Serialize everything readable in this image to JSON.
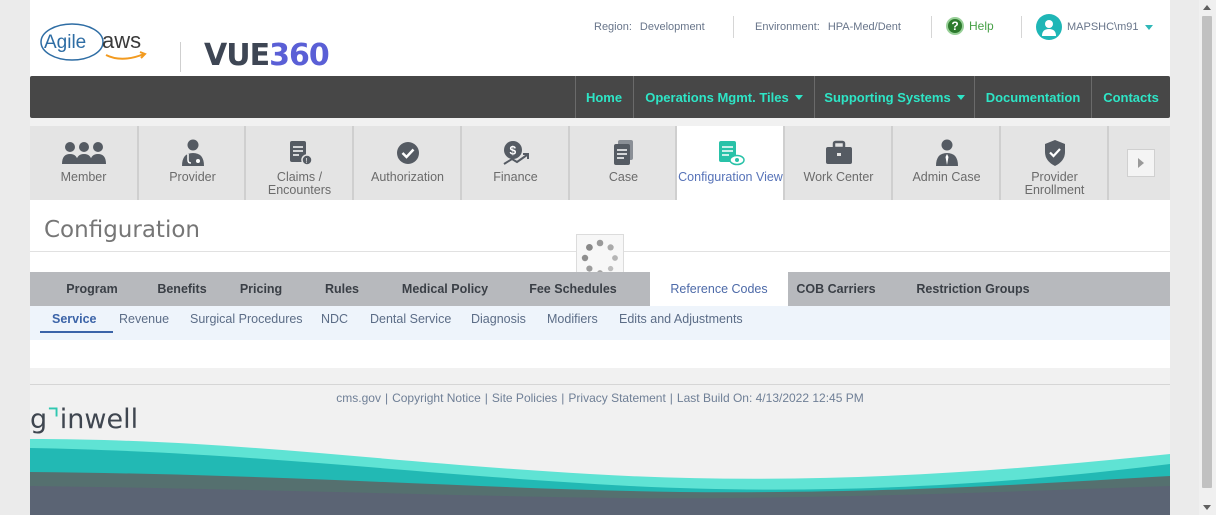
{
  "header": {
    "logo_agile_text": "Agile",
    "logo_aws_text": "aws",
    "logo_vue_text": "VUE",
    "logo_vue_num": "360",
    "region_label": "Region:",
    "region_value": "Development",
    "environment_label": "Environment:",
    "environment_value": "HPA-Med/Dent",
    "help_label": "Help",
    "user_label": "MAPSHC\\m91"
  },
  "nav": {
    "items": [
      {
        "label": "Home"
      },
      {
        "label": "Operations Mgmt. Tiles"
      },
      {
        "label": "Supporting Systems"
      },
      {
        "label": "Documentation"
      },
      {
        "label": "Contacts"
      }
    ]
  },
  "tiles": [
    {
      "label": "Member",
      "icon": "members-icon"
    },
    {
      "label": "Provider",
      "icon": "provider-icon"
    },
    {
      "label": "Claims / Encounters",
      "icon": "claims-icon"
    },
    {
      "label": "Authorization",
      "icon": "check-circle-icon"
    },
    {
      "label": "Finance",
      "icon": "finance-icon"
    },
    {
      "label": "Case",
      "icon": "case-icon"
    },
    {
      "label": "Configuration View",
      "icon": "configuration-icon"
    },
    {
      "label": "Work Center",
      "icon": "briefcase-icon"
    },
    {
      "label": "Admin Case",
      "icon": "admin-icon"
    },
    {
      "label": "Provider Enrollment",
      "icon": "shield-check-icon"
    }
  ],
  "page": {
    "title": "Configuration"
  },
  "tabs": [
    {
      "label": "Program"
    },
    {
      "label": "Benefits"
    },
    {
      "label": "Pricing"
    },
    {
      "label": "Rules"
    },
    {
      "label": "Medical Policy"
    },
    {
      "label": "Fee Schedules"
    },
    {
      "label": "Reference Codes"
    },
    {
      "label": "COB Carriers"
    },
    {
      "label": "Restriction Groups"
    }
  ],
  "subtabs": [
    {
      "label": "Service"
    },
    {
      "label": "Revenue"
    },
    {
      "label": "Surgical Procedures"
    },
    {
      "label": "NDC"
    },
    {
      "label": "Dental Service"
    },
    {
      "label": "Diagnosis"
    },
    {
      "label": "Modifiers"
    },
    {
      "label": "Edits and Adjustments"
    }
  ],
  "footer": {
    "links": [
      {
        "label": "cms.gov"
      },
      {
        "label": "Copyright Notice"
      },
      {
        "label": "Site Policies"
      },
      {
        "label": "Privacy Statement"
      }
    ],
    "build_label": "Last Build On: 4/13/2022 12:45 PM",
    "brand_prefix": "g",
    "brand_mark": "⌝",
    "brand_suffix": "inwell"
  },
  "colors": {
    "accent_teal": "#2ee5c6",
    "nav_bg": "#474747",
    "active_tile_text": "#5773b8",
    "tab_bar_bg": "#b7b9bd"
  }
}
